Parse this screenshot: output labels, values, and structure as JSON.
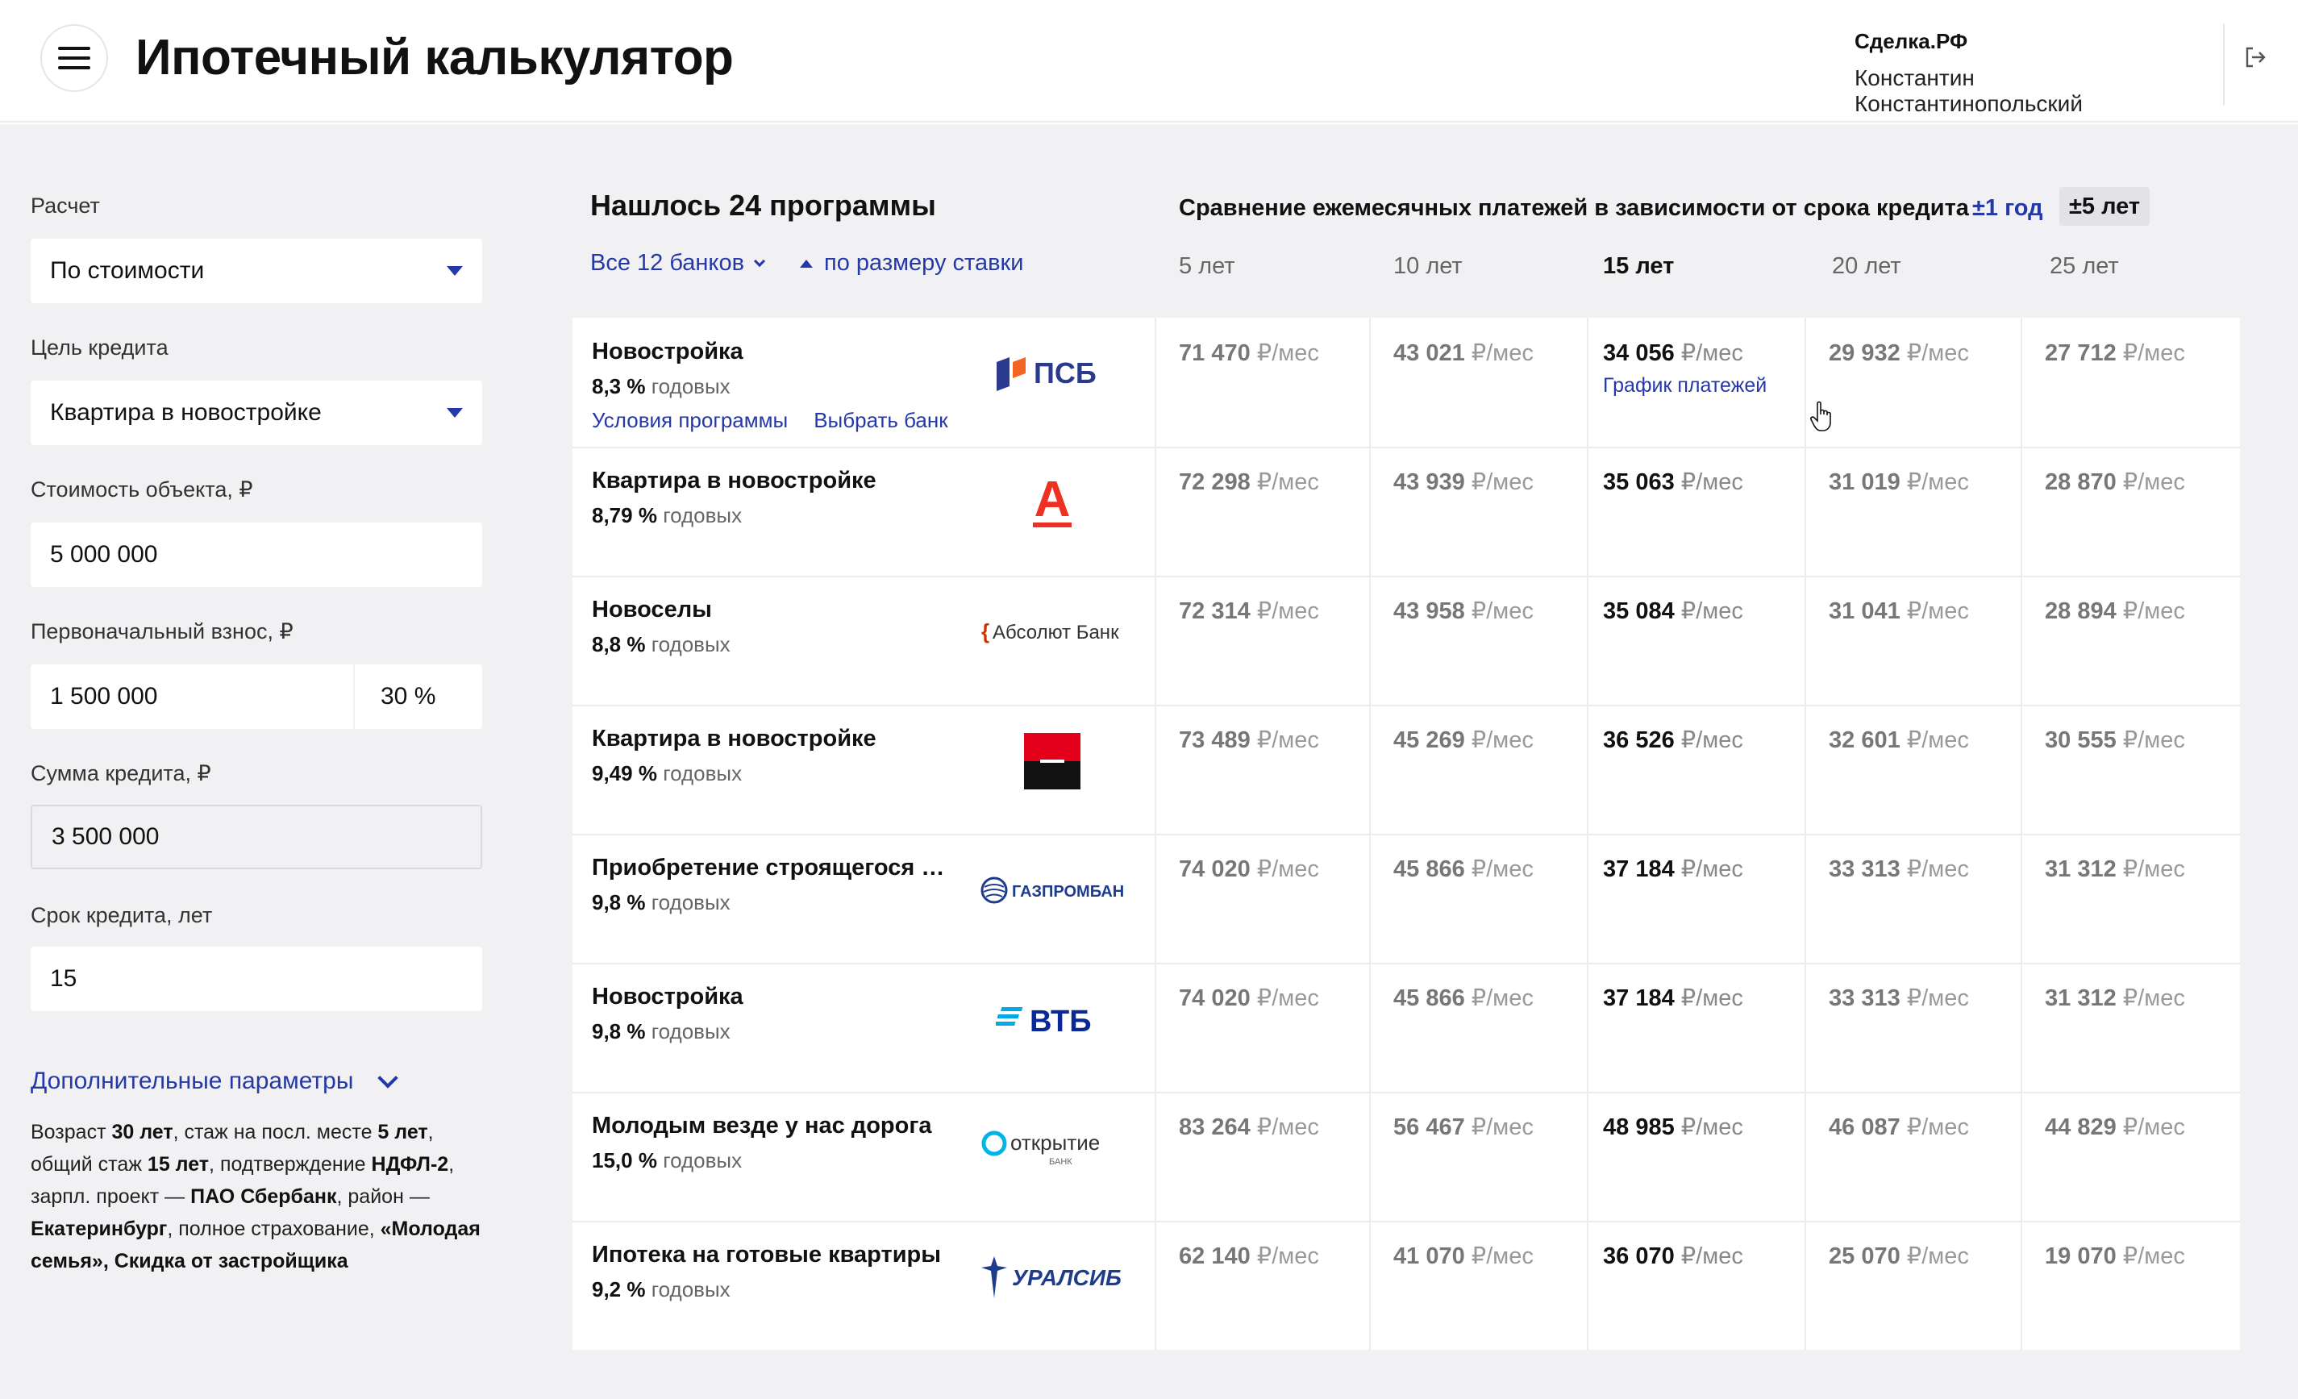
{
  "header": {
    "title": "Ипотечный калькулятор",
    "org": "Сделка.РФ",
    "user": "Константин Константинопольский"
  },
  "sidebar": {
    "calc_label": "Расчет",
    "calc_value": "По стоимости",
    "goal_label": "Цель кредита",
    "goal_value": "Квартира в новостройке",
    "cost_label": "Стоимость объекта, ₽",
    "cost_value": "5 000 000",
    "down_label": "Первоначальный взнос, ₽",
    "down_value": "1 500 000",
    "down_percent": "30 %",
    "loan_label": "Сумма кредита, ₽",
    "loan_value": "3 500 000",
    "term_label": "Срок кредита, лет",
    "term_value": "15",
    "extra_link": "Дополнительные параметры",
    "params": {
      "t1": "Возраст ",
      "b1": "30 лет",
      "t2": ", стаж на посл. месте ",
      "b2": "5 лет",
      "t3": ", общий стаж ",
      "b3": "15 лет",
      "t4": ", подтверждение ",
      "b4": "НДФЛ-2",
      "t5": ", зарпл. проект — ",
      "b5": "ПАО Сбербанк",
      "t6": ", район — ",
      "b6": "Екатеринбург",
      "t7": ", полное страхование, ",
      "b7": "«Молодая семья», Скидка от застройщика"
    }
  },
  "main": {
    "results_title": "Нашлось 24 программы",
    "filter_banks": "Все 12 банков",
    "sort_label": "по размеру ставки",
    "compare_title": "Сравнение ежемесячных платежей в зависимости от срока кредита",
    "range_1": "±1 год",
    "range_5": "±5 лет",
    "columns": [
      "5 лет",
      "10 лет",
      "15 лет",
      "20 лет",
      "25 лет"
    ],
    "unit": "₽/мес",
    "rate_suffix": "годовых",
    "link_conditions": "Условия программы",
    "link_choose": "Выбрать банк",
    "link_schedule": "График платежей",
    "rows": [
      {
        "name": "Новостройка",
        "rate": "8,3 %",
        "bank": "ПСБ",
        "payments": [
          "71 470",
          "43 021",
          "34 056",
          "29 932",
          "27 712"
        ]
      },
      {
        "name": "Квартира в новостройке",
        "rate": "8,79 %",
        "bank": "А",
        "payments": [
          "72 298",
          "43 939",
          "35 063",
          "31 019",
          "28 870"
        ]
      },
      {
        "name": "Новоселы",
        "rate": "8,8 %",
        "bank": "Абсолют Банк",
        "payments": [
          "72 314",
          "43 958",
          "35 084",
          "31 041",
          "28 894"
        ]
      },
      {
        "name": "Квартира в новостройке",
        "rate": "9,49 %",
        "bank": "Росбанк",
        "payments": [
          "73 489",
          "45 269",
          "36 526",
          "32 601",
          "30 555"
        ]
      },
      {
        "name": "Приобретение строящегося ж...",
        "rate": "9,8 %",
        "bank": "ГАЗПРОМБАНК",
        "payments": [
          "74 020",
          "45 866",
          "37 184",
          "33 313",
          "31 312"
        ]
      },
      {
        "name": "Новостройка",
        "rate": "9,8 %",
        "bank": "ВТБ",
        "payments": [
          "74 020",
          "45 866",
          "37 184",
          "33 313",
          "31 312"
        ]
      },
      {
        "name": "Молодым везде у нас дорога",
        "rate": "15,0 %",
        "bank": "открытие",
        "bank_sub": "БАНК",
        "payments": [
          "83 264",
          "56 467",
          "48 985",
          "46 087",
          "44 829"
        ]
      },
      {
        "name": "Ипотека на готовые квартиры",
        "rate": "9,2 %",
        "bank": "УРАЛСИБ",
        "payments": [
          "62 140",
          "41 070",
          "36 070",
          "25 070",
          "19 070"
        ]
      }
    ]
  },
  "colors": {
    "accent": "#2538a8",
    "sidebar_bg": "#f1f1f3",
    "psb": "#2a3a8c",
    "alfa": "#ef3124",
    "rosbank_red": "#e2001a",
    "gazprom": "#1d3c8f",
    "vtb": "#0a2896",
    "otkritie": "#00b4e6",
    "uralsib": "#1f3c8c",
    "absolut": "#cc3300"
  }
}
